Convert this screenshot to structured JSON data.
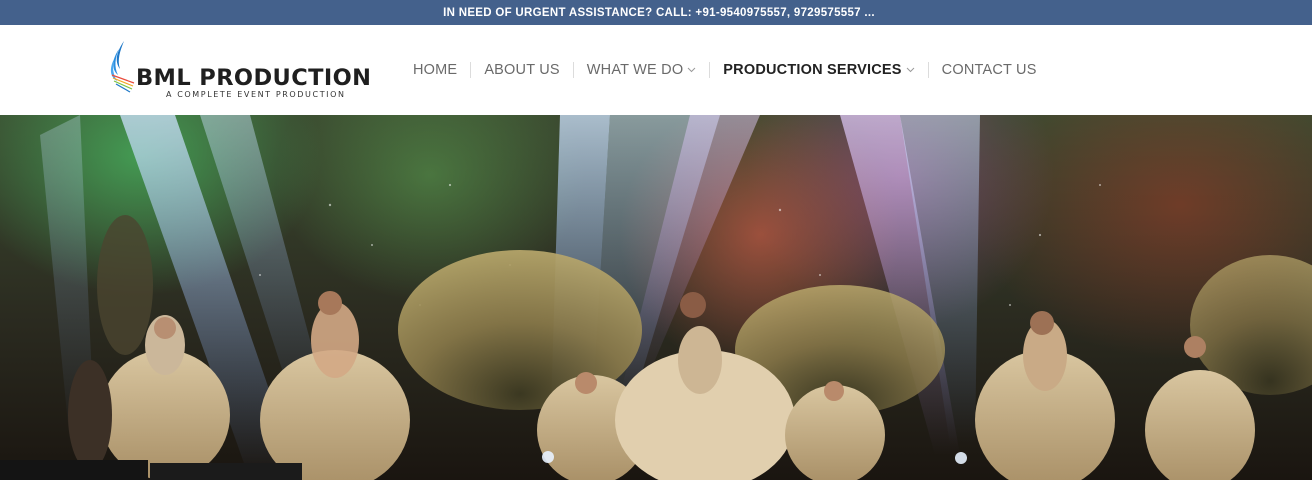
{
  "topbar": {
    "text": "IN NEED OF URGENT ASSISTANCE? CALL: +91-9540975557, 9729575557 ..."
  },
  "logo": {
    "name": "BML PRODUCTION",
    "tagline": "A COMPLETE EVENT PRODUCTION"
  },
  "nav": {
    "items": [
      {
        "label": "HOME"
      },
      {
        "label": "ABOUT US"
      },
      {
        "label": "WHAT WE DO"
      },
      {
        "label": "PRODUCTION SERVICES"
      },
      {
        "label": "CONTACT US"
      }
    ]
  },
  "colors": {
    "topbar_bg": "#44618c",
    "nav_text": "#6a6a6a",
    "nav_active": "#222222",
    "logo_blue": "#1e78c8"
  },
  "hero": {
    "image": "stage-dance-performance-photo"
  }
}
